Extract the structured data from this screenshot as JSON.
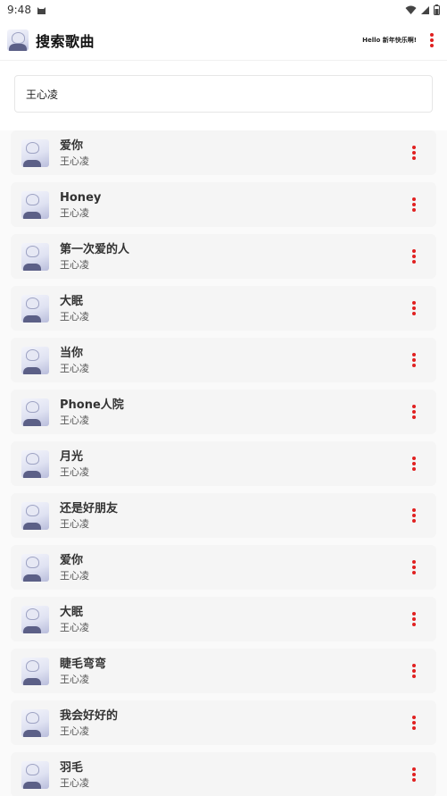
{
  "status": {
    "time": "9:48"
  },
  "appbar": {
    "title": "搜索歌曲",
    "greeting": "Hello 新年快乐啊!"
  },
  "search": {
    "value": "王心凌"
  },
  "songs": [
    {
      "name": "爱你",
      "artist": "王心凌"
    },
    {
      "name": "Honey",
      "artist": "王心凌"
    },
    {
      "name": "第一次爱的人",
      "artist": "王心凌"
    },
    {
      "name": "大眠",
      "artist": "王心凌"
    },
    {
      "name": "当你",
      "artist": "王心凌"
    },
    {
      "name": "Phone人院",
      "artist": "王心凌"
    },
    {
      "name": "月光",
      "artist": "王心凌"
    },
    {
      "name": "还是好朋友",
      "artist": "王心凌"
    },
    {
      "name": "爱你",
      "artist": "王心凌"
    },
    {
      "name": "大眠",
      "artist": "王心凌"
    },
    {
      "name": "睫毛弯弯",
      "artist": "王心凌"
    },
    {
      "name": "我会好好的",
      "artist": "王心凌"
    },
    {
      "name": "羽毛",
      "artist": "王心凌"
    }
  ],
  "colors": {
    "accent": "#e02020",
    "card": "#f5f5f5"
  },
  "icons": {
    "status_left": [
      "cat-icon"
    ],
    "status_right": [
      "wifi-icon",
      "signal-icon",
      "battery-icon"
    ],
    "menu": "more-vert-icon"
  }
}
